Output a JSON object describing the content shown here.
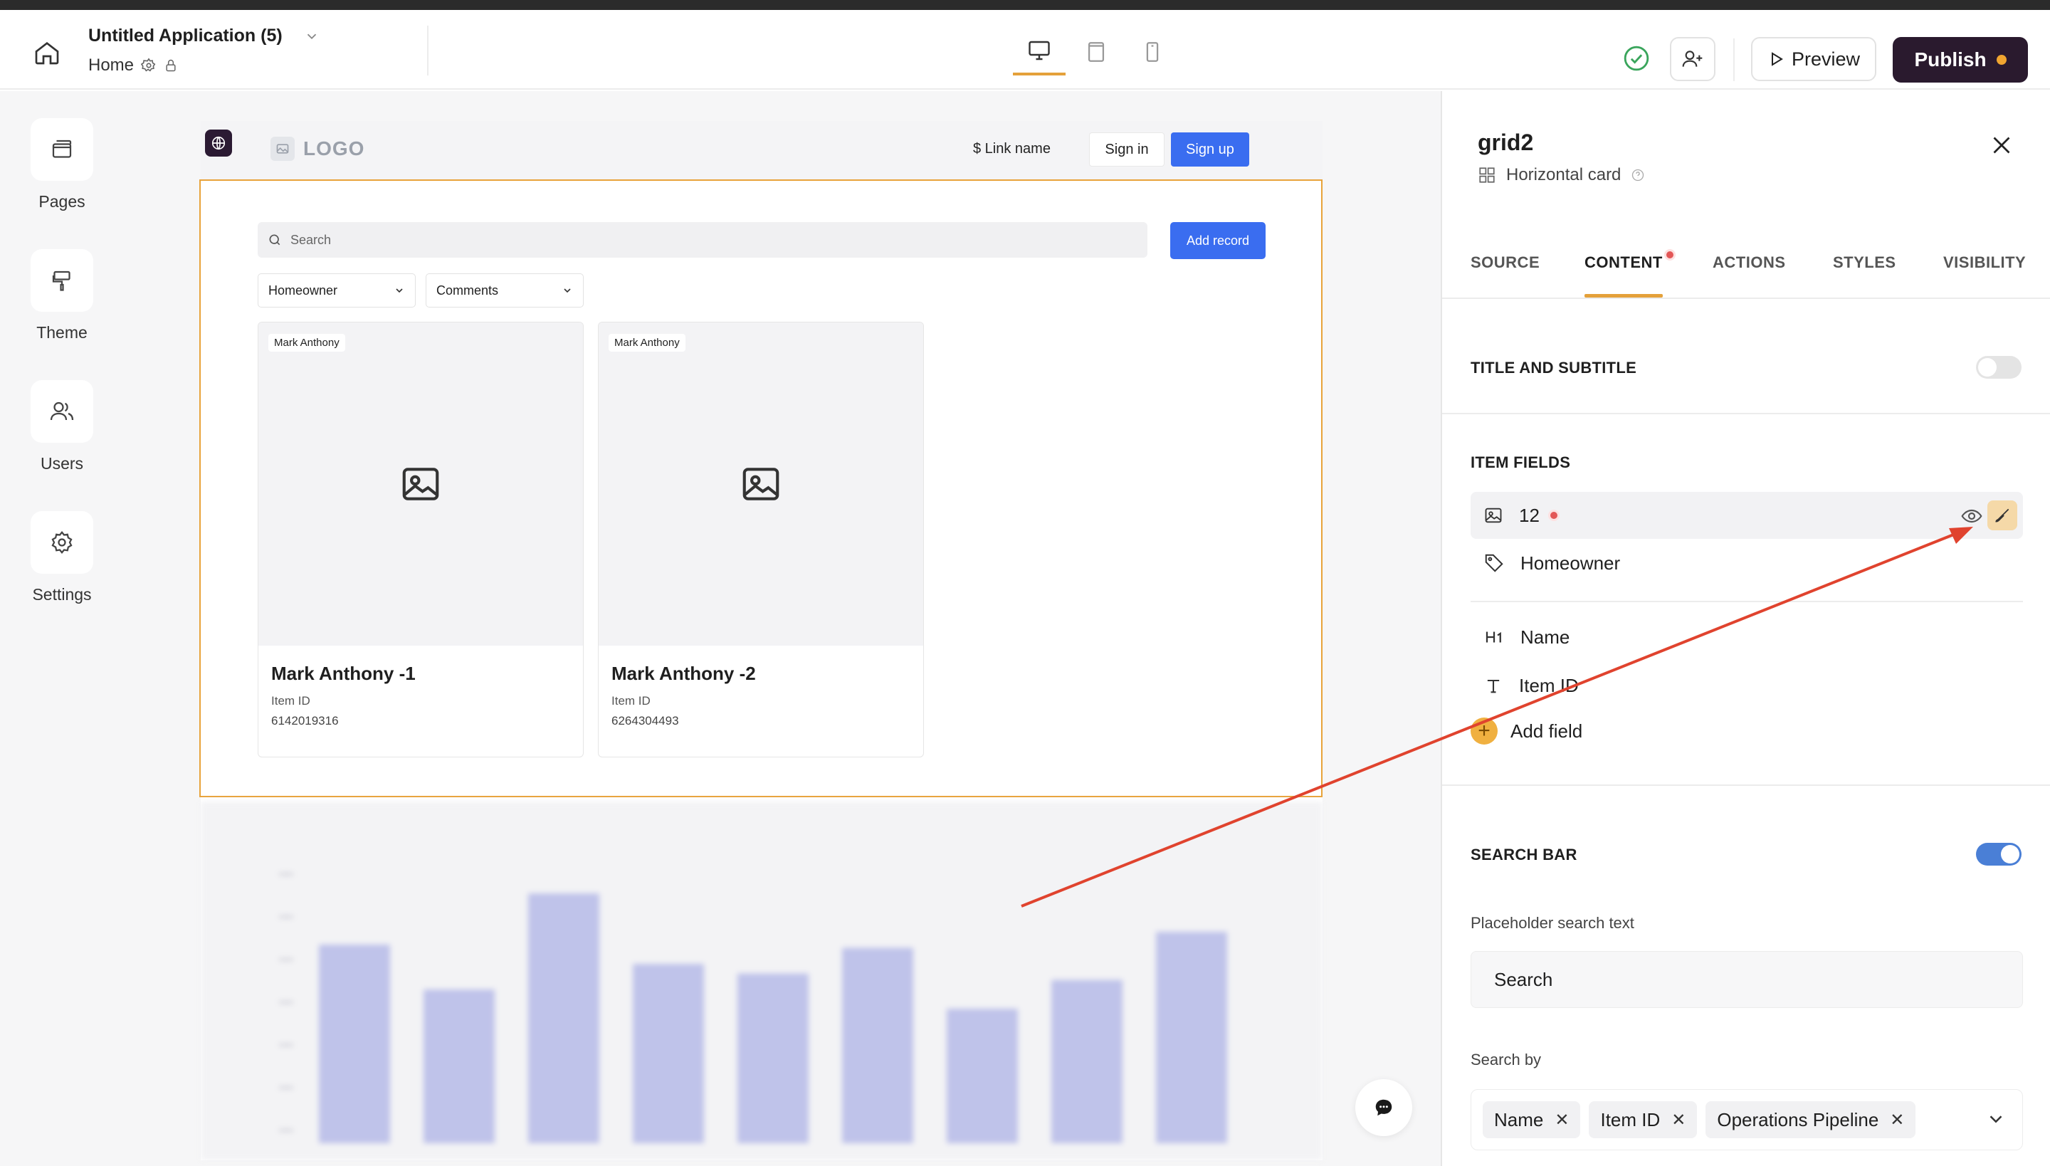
{
  "header": {
    "app_title": "Untitled Application (5)",
    "page_name": "Home",
    "preview_label": "Preview",
    "publish_label": "Publish",
    "devices": [
      "desktop",
      "tablet",
      "mobile"
    ],
    "active_device": "desktop"
  },
  "leftnav": {
    "items": [
      {
        "label": "Pages",
        "icon": "pages-icon"
      },
      {
        "label": "Theme",
        "icon": "paint-roller-icon"
      },
      {
        "label": "Users",
        "icon": "users-icon"
      },
      {
        "label": "Settings",
        "icon": "gear-icon"
      }
    ]
  },
  "canvas": {
    "logo": "LOGO",
    "link_name": "$ Link name",
    "sign_in": "Sign in",
    "sign_up": "Sign up",
    "search_placeholder": "Search",
    "add_record": "Add record",
    "filters": [
      "Homeowner",
      "Comments"
    ],
    "cards": [
      {
        "tag": "Mark Anthony",
        "name": "Mark Anthony -1",
        "id_label": "Item ID",
        "id_value": "6142019316"
      },
      {
        "tag": "Mark Anthony",
        "name": "Mark Anthony -2",
        "id_label": "Item ID",
        "id_value": "6264304493"
      }
    ],
    "blurred_chart_values": [
      62,
      48,
      78,
      56,
      53,
      61,
      42,
      51,
      66
    ]
  },
  "panel": {
    "title": "grid2",
    "subtitle": "Horizontal card",
    "tabs": [
      "SOURCE",
      "CONTENT",
      "ACTIONS",
      "STYLES",
      "VISIBILITY"
    ],
    "active_tab": "CONTENT",
    "title_subtitle": {
      "label": "TITLE AND SUBTITLE",
      "enabled": false
    },
    "item_fields_label": "ITEM FIELDS",
    "image_field": "12",
    "tag_field": "Homeowner",
    "fields": [
      {
        "icon": "heading-icon",
        "label": "Name"
      },
      {
        "icon": "text-icon",
        "label": "Item ID"
      }
    ],
    "add_field": "Add field",
    "search_bar": {
      "label": "SEARCH BAR",
      "enabled": true
    },
    "placeholder_label": "Placeholder search text",
    "placeholder_value": "Search",
    "search_by_label": "Search by",
    "search_by": [
      "Name",
      "Item ID",
      "Operations Pipeline"
    ]
  },
  "colors": {
    "accent": "#e4a13a",
    "publish_bg": "#2a1a2e",
    "primary_blue": "#3a6df0",
    "toggle_on": "#4a7fd6",
    "annotation_arrow": "#e0432e"
  }
}
